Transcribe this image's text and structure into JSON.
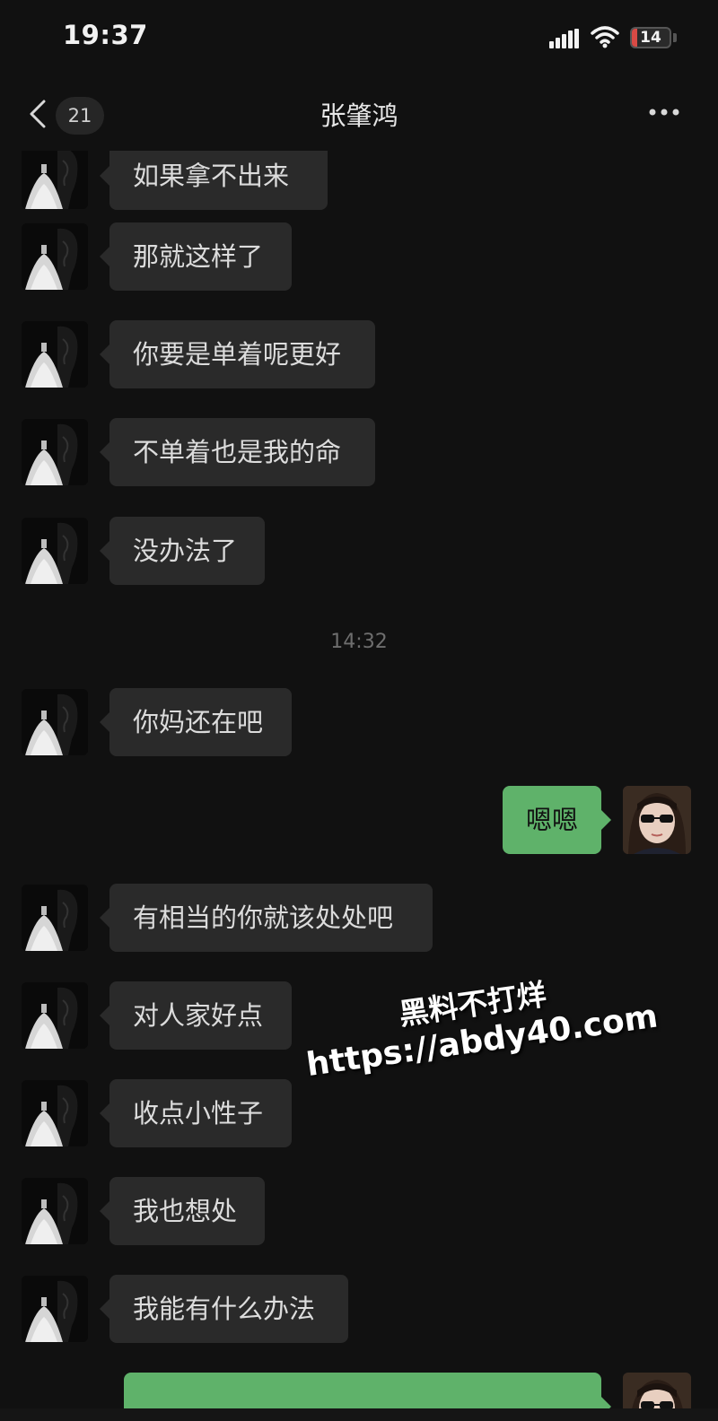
{
  "status_bar": {
    "time": "19:37",
    "battery": "14",
    "battery_color": "#d94a45"
  },
  "nav": {
    "back_icon": "chevron-left-icon",
    "unread_count": "21",
    "title": "张肇鸿",
    "more_icon": "more-horizontal-icon"
  },
  "messages": [
    {
      "side": "left",
      "text": "如果拿不出来"
    },
    {
      "side": "left",
      "text": "那就这样了"
    },
    {
      "side": "left",
      "text": "你要是单着呢更好"
    },
    {
      "side": "left",
      "text": "不单着也是我的命"
    },
    {
      "side": "left",
      "text": "没办法了"
    },
    {
      "side": "time",
      "text": "14:32"
    },
    {
      "side": "left",
      "text": "你妈还在吧"
    },
    {
      "side": "right",
      "text": "嗯嗯"
    },
    {
      "side": "left",
      "text": "有相当的你就该处处吧"
    },
    {
      "side": "left",
      "text": "对人家好点"
    },
    {
      "side": "left",
      "text": "收点小性子"
    },
    {
      "side": "left",
      "text": "我也想处"
    },
    {
      "side": "left",
      "text": "我能有什么办法"
    },
    {
      "side": "right",
      "text": ""
    }
  ],
  "watermark": {
    "line1": "黑料不打烊",
    "line2": "https://abdy40.com"
  },
  "colors": {
    "background": "#111111",
    "incoming_bubble": "#2a2a2a",
    "outgoing_bubble": "#5fb26a"
  }
}
